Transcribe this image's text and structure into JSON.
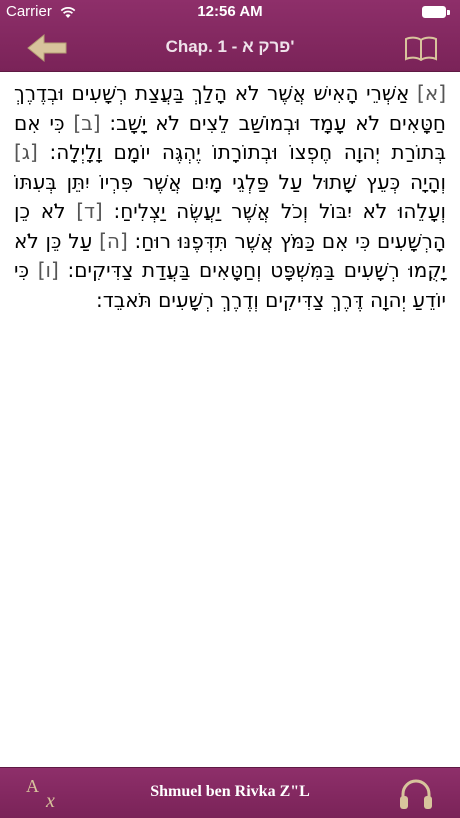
{
  "status_bar": {
    "carrier": "Carrier",
    "time": "12:56 AM"
  },
  "nav": {
    "title": "Chap. 1 - פרק א'",
    "back_icon": "back-arrow-icon",
    "book_icon": "book-icon"
  },
  "chapter": {
    "verses": [
      {
        "num": "[א]",
        "text": "אַשְׁרֵי הָאִישׁ אֲשֶׁר לֹא הָלַךְ בַּעֲצַת רְשָׁעִים וּבְדֶרֶךְ חַטָּאִים לֹא עָמָד וּבְמוֹשַׁב לֵצִים לֹא יָשָׁב:"
      },
      {
        "num": "[ב]",
        "text": "כִּי אִם בְּתוֹרַת יְהוָה חֶפְצוֹ וּבְתוֹרָתוֹ יֶהְגֶּה יוֹמָם וָלָיְלָה:"
      },
      {
        "num": "[ג]",
        "text": "וְהָיָה כְּעֵץ שָׁתוּל עַל פַּלְגֵי מָיִם אֲשֶׁר פִּרְיוֹ יִתֵּן בְּעִתּוֹ וְעָלֵהוּ לֹא יִבּוֹל וְכֹל אֲשֶׁר יַעֲשֶׂה יַצְלִיחַ:"
      },
      {
        "num": "[ד]",
        "text": "לֹא כֵן הָרְשָׁעִים כִּי אִם כַּמֹּץ אֲשֶׁר תִּדְּפֶנּוּ רוּחַ:"
      },
      {
        "num": "[ה]",
        "text": "עַל כֵּן לֹא יָקֻמוּ רְשָׁעִים בַּמִּשְׁפָּט וְחַטָּאִים בַּעֲדַת צַדִּיקִים:"
      },
      {
        "num": "[ו]",
        "text": "כִּי יוֹדֵעַ יְהוָה דֶּרֶךְ צַדִּיקִים וְדֶרֶךְ רְשָׁעִים תֹּאבֵד:"
      }
    ]
  },
  "bottom_bar": {
    "font_icon_A": "A",
    "font_icon_x": "x",
    "author": "Shmuel ben Rivka Z\"L",
    "audio_icon": "headphones-icon"
  },
  "colors": {
    "bar": "#7f2660",
    "icon": "#d8c49c"
  }
}
